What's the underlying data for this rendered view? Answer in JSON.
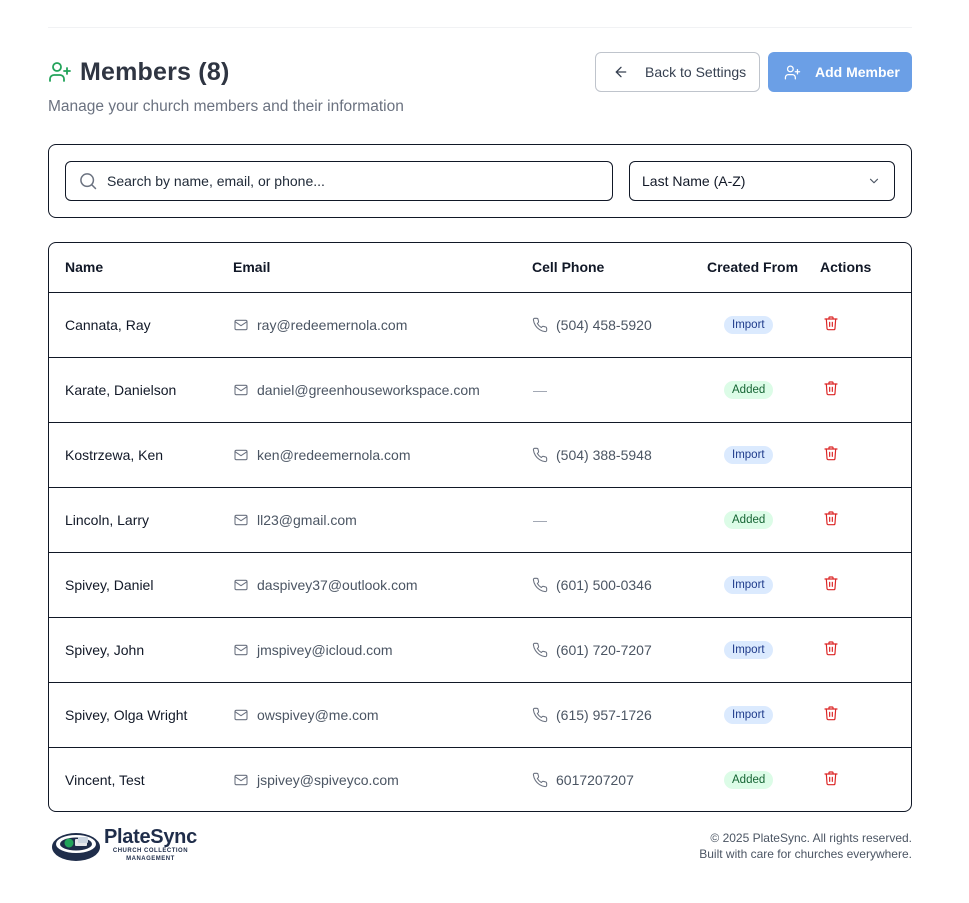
{
  "header": {
    "title": "Members (8)",
    "subtitle": "Manage your church members and their information",
    "back_button_label": "Back to Settings",
    "add_button_label": "Add Member"
  },
  "filters": {
    "search_placeholder": "Search by name, email, or phone...",
    "sort_selected": "Last Name (A-Z)"
  },
  "table": {
    "columns": [
      "Name",
      "Email",
      "Cell Phone",
      "Created From",
      "Actions"
    ],
    "rows": [
      {
        "name": "Cannata, Ray",
        "email": "ray@redeemernola.com",
        "phone": "(504) 458-5920",
        "created_from": "Import"
      },
      {
        "name": "Karate, Danielson",
        "email": "daniel@greenhouseworkspace.com",
        "phone": "—",
        "created_from": "Added"
      },
      {
        "name": "Kostrzewa, Ken",
        "email": "ken@redeemernola.com",
        "phone": "(504) 388-5948",
        "created_from": "Import"
      },
      {
        "name": "Lincoln, Larry",
        "email": "ll23@gmail.com",
        "phone": "—",
        "created_from": "Added"
      },
      {
        "name": "Spivey, Daniel",
        "email": "daspivey37@outlook.com",
        "phone": "(601) 500-0346",
        "created_from": "Import"
      },
      {
        "name": "Spivey, John",
        "email": "jmspivey@icloud.com",
        "phone": "(601) 720-7207",
        "created_from": "Import"
      },
      {
        "name": "Spivey, Olga Wright",
        "email": "owspivey@me.com",
        "phone": "(615) 957-1726",
        "created_from": "Import"
      },
      {
        "name": "Vincent, Test",
        "email": "jspivey@spiveyco.com",
        "phone": "6017207207",
        "created_from": "Added"
      }
    ]
  },
  "footer": {
    "logo_name": "PlateSync",
    "logo_tagline_1": "CHURCH COLLECTION",
    "logo_tagline_2": "MANAGEMENT",
    "copyright": "© 2025 PlateSync. All rights reserved.",
    "tagline": "Built with care for churches everywhere."
  },
  "icons": {
    "title": "user-plus-icon",
    "back": "arrow-left-icon",
    "add": "user-plus-icon",
    "search": "search-icon",
    "sort": "chevron-down-icon",
    "email": "mail-icon",
    "phone": "phone-icon",
    "delete": "trash-icon"
  },
  "colors": {
    "accent": "#6b9fe6",
    "title_icon": "#22a35a",
    "delete": "#dc2626",
    "import_badge_bg": "#dbeafe",
    "added_badge_bg": "#dcfce7"
  }
}
